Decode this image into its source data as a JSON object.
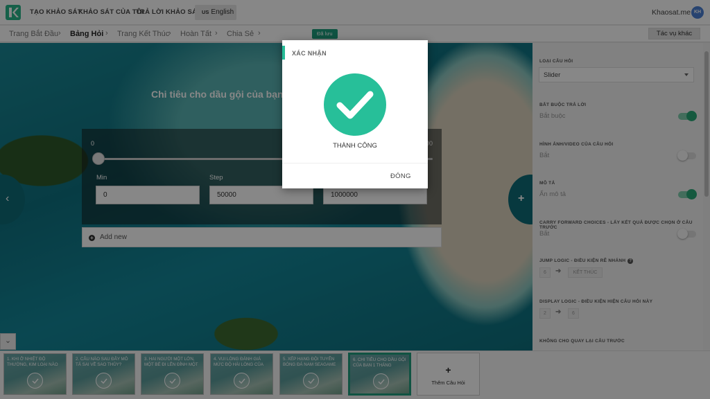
{
  "topbar": {
    "nav": [
      "TẠO KHẢO SÁT",
      "KHẢO SÁT CỦA TÔI",
      "TRẢ LỜI KHẢO SÁT"
    ],
    "lang_code": "US",
    "lang_label": "English",
    "site_name": "Khaosat.me",
    "avatar_initials": "KH"
  },
  "breadcrumb": {
    "items": [
      "Trang Bắt Đầu",
      "Bảng Hỏi",
      "Trang Kết Thúc",
      "Hoàn Tất",
      "Chia Sẻ"
    ],
    "active_index": 1,
    "saved_label": "Đã lưu",
    "tasks_button": "Tác vụ khác"
  },
  "question": {
    "title": "Chi tiêu cho dầu gội của bạn 1",
    "slider_min_label": "0",
    "slider_max_label": "00",
    "slider_position": 0,
    "fields": [
      {
        "label": "Min",
        "value": "0"
      },
      {
        "label": "Step",
        "value": "50000"
      },
      {
        "label": "",
        "value": "1000000"
      }
    ],
    "add_new_label": "Add new"
  },
  "panel": {
    "question_type_label": "LOẠI CÂU HỎI",
    "question_type_value": "Slider",
    "settings": [
      {
        "label": "BẮT BUỘC TRẢ LỜI",
        "value": "Bắt buộc",
        "on": true
      },
      {
        "label": "HÌNH ẢNH/VIDEO CỦA CÂU HỎI",
        "value": "Bắt",
        "on": false
      },
      {
        "label": "MÔ TẢ",
        "value": "Ẩn mô tả",
        "on": true
      },
      {
        "label": "CARRY FORWARD CHOICES - LẤY KẾT QUẢ ĐƯỢC CHỌN Ở CÂU TRƯỚC",
        "value": "Bắt",
        "on": false
      }
    ],
    "jump_logic_label": "JUMP LOGIC - ĐIỀU KIỆN RẼ NHÁNH",
    "jump_logic_from": "6",
    "jump_logic_to": "KẾT THÚC",
    "display_logic_label": "DISPLAY LOGIC - ĐIỀU KIỆN HIỆN CÂU HỎI NÀY",
    "display_logic_from": "2",
    "display_logic_to": "6",
    "no_back_label": "KHÔNG CHO QUAY LẠI CÂU TRƯỚC"
  },
  "thumbnails": [
    "1. KHI Ở NHIỆT ĐỘ THƯỜNG, KIM LOẠI NÀO",
    "2. CÂU NÀO SAU ĐÂY MÔ TẢ SAI VỀ SAO THỦY?",
    "3. HAI NGƯỜI MỘT LỚN, MỘT BÉ ĐI LÊN ĐỈNH MỘT",
    "4. VUI LÒNG ĐÁNH GIÁ MỨC ĐỘ HÀI LÒNG CỦA",
    "5. XẾP HẠNG ĐỘI TUYỂN BÓNG ĐÁ NAM SEAGAME",
    "6. CHI TIÊU CHO DẦU GỘI CỦA BẠN 1 THÁNG"
  ],
  "active_thumbnail": 5,
  "add_question_label": "Thêm Câu Hỏi",
  "modal": {
    "title": "XÁC NHẬN",
    "message": "THÀNH CÔNG",
    "close_label": "ĐÓNG"
  },
  "colors": {
    "accent": "#27bf99",
    "saved_badge": "#1e9e7e",
    "toggle_on": "#29a977"
  }
}
